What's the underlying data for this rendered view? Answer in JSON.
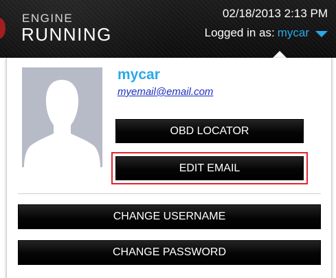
{
  "header": {
    "brand_line1": "ENGINE",
    "brand_line2": "RUNNING",
    "datetime": "02/18/2013 2:13 PM",
    "logged_in_prefix": "Logged in as:",
    "logged_in_user": "mycar"
  },
  "profile": {
    "username": "mycar",
    "email": "myemail@email.com",
    "avatar": "person-silhouette-icon"
  },
  "buttons": {
    "obd_locator": "OBD LOCATOR",
    "edit_email": "EDIT EMAIL",
    "change_username": "CHANGE USERNAME",
    "change_password": "CHANGE PASSWORD"
  },
  "colors": {
    "accent_blue": "#29a9e8",
    "highlight_red": "#e0242c",
    "header_dark": "#111111",
    "link_blue": "#1a2fbf"
  }
}
